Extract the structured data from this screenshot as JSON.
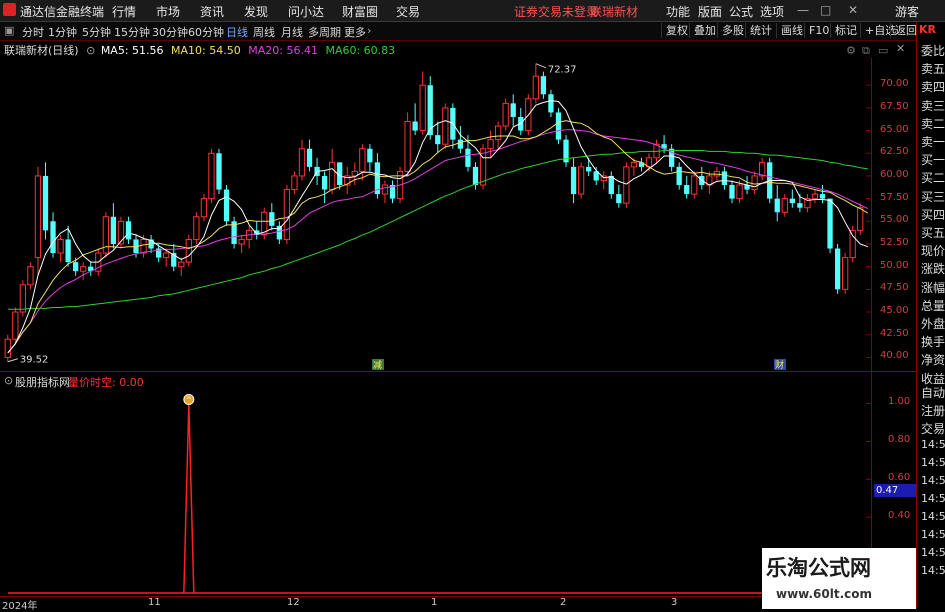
{
  "menubar": {
    "app_title": "通达信金融终端",
    "menus": [
      "行情",
      "市场",
      "资讯",
      "发现",
      "问小达",
      "财富圈",
      "交易"
    ],
    "notice": "证券交易未登录",
    "stock": "联瑞新材",
    "right_menus": [
      "功能",
      "版面",
      "公式",
      "选项"
    ],
    "guest": "游客"
  },
  "periodbar": {
    "periods": [
      "分时",
      "1分钟",
      "5分钟",
      "15分钟",
      "30分钟",
      "60分钟",
      "日线",
      "周线",
      "月线",
      "多周期",
      "更多"
    ],
    "active_period": "日线",
    "tools": [
      "复权",
      "叠加",
      "多股",
      "统计",
      "画线",
      "F10",
      "标记",
      "+自选",
      "返回"
    ]
  },
  "main_chart": {
    "title": "联瑞新材(日线)",
    "ma_labels": [
      {
        "name": "MA5: 51.56",
        "color": "#ffffff"
      },
      {
        "name": "MA10: 54.50",
        "color": "#f0e060"
      },
      {
        "name": "MA20: 56.41",
        "color": "#e040e0"
      },
      {
        "name": "MA60: 60.83",
        "color": "#30d030"
      }
    ],
    "high_mark": "72.37",
    "low_mark": "39.52",
    "event_markers": [
      "减",
      "财"
    ]
  },
  "sub_chart": {
    "title": "股朋指标网",
    "indicator": "量价时空: 0.00",
    "current_value": "0.47"
  },
  "right_panel": {
    "code": "KR",
    "items": [
      "委比",
      "卖五",
      "卖四",
      "卖三",
      "卖二",
      "卖一",
      "买一",
      "买二",
      "买三",
      "买四",
      "买五",
      "现价",
      "涨跌",
      "涨幅",
      "总量",
      "外盘",
      "换手",
      "净资",
      "收益"
    ],
    "sub_items": [
      "自动",
      "注册",
      "交易"
    ],
    "times": [
      "14:5",
      "14:5",
      "14:5",
      "14:5",
      "14:5",
      "14:5",
      "14:5",
      "14:5"
    ]
  },
  "x_axis": [
    "2024年",
    "11",
    "12",
    "1",
    "2",
    "3"
  ],
  "watermark": {
    "brand": "乐淘公式网",
    "url": "www.60lt.com"
  },
  "chart_data": {
    "type": "candlestick",
    "ylim": [
      38.5,
      73
    ],
    "y_ticks": [
      "70.00",
      "67.50",
      "65.00",
      "62.50",
      "60.00",
      "57.50",
      "55.00",
      "52.50",
      "50.00",
      "47.50",
      "45.00",
      "42.50",
      "40.00"
    ],
    "sub_ylim": [
      0,
      1.05
    ],
    "sub_y_ticks": [
      "1.00",
      "0.80",
      "0.60",
      "0.40"
    ],
    "colors": {
      "up": "#ff3232",
      "down": "#54ffff",
      "ma5": "#ffffff",
      "ma10": "#f0e060",
      "ma20": "#e040e0",
      "ma60": "#30d030",
      "indicator": "#ff2020"
    },
    "ohlc": [
      [
        40.0,
        42.5,
        39.52,
        42.0
      ],
      [
        42.0,
        45.5,
        41.5,
        45.0
      ],
      [
        45.0,
        48.5,
        44.5,
        48.0
      ],
      [
        48.0,
        50.5,
        47.5,
        50.0
      ],
      [
        51.0,
        61.0,
        49.0,
        60.0
      ],
      [
        60.0,
        61.5,
        53.0,
        54.0
      ],
      [
        55.0,
        56.0,
        51.0,
        51.5
      ],
      [
        51.5,
        53.5,
        50.5,
        53.0
      ],
      [
        53.0,
        54.5,
        50.0,
        50.5
      ],
      [
        50.5,
        51.0,
        49.0,
        49.5
      ],
      [
        49.5,
        50.5,
        48.5,
        50.0
      ],
      [
        50.0,
        50.5,
        49.0,
        49.5
      ],
      [
        49.5,
        52.0,
        49.0,
        51.5
      ],
      [
        51.5,
        56.0,
        51.0,
        55.5
      ],
      [
        55.5,
        57.0,
        52.0,
        52.5
      ],
      [
        52.5,
        55.5,
        52.0,
        55.0
      ],
      [
        55.0,
        55.5,
        52.5,
        53.0
      ],
      [
        53.0,
        53.5,
        51.0,
        51.5
      ],
      [
        51.5,
        53.5,
        51.0,
        53.0
      ],
      [
        53.0,
        53.5,
        51.5,
        52.0
      ],
      [
        52.0,
        52.5,
        50.5,
        51.0
      ],
      [
        51.0,
        52.0,
        50.0,
        51.5
      ],
      [
        51.5,
        52.5,
        49.5,
        50.0
      ],
      [
        50.0,
        51.0,
        49.0,
        50.5
      ],
      [
        50.5,
        53.5,
        50.0,
        53.0
      ],
      [
        53.0,
        56.0,
        52.5,
        55.5
      ],
      [
        55.5,
        58.0,
        55.0,
        57.5
      ],
      [
        57.5,
        63.0,
        57.0,
        62.5
      ],
      [
        62.5,
        63.0,
        58.0,
        58.5
      ],
      [
        58.5,
        59.0,
        54.5,
        55.0
      ],
      [
        55.0,
        55.5,
        52.0,
        52.5
      ],
      [
        52.5,
        53.5,
        51.5,
        53.0
      ],
      [
        53.0,
        54.5,
        52.0,
        54.0
      ],
      [
        54.0,
        55.0,
        53.0,
        53.5
      ],
      [
        53.5,
        56.5,
        53.0,
        56.0
      ],
      [
        56.0,
        57.0,
        54.0,
        54.5
      ],
      [
        54.5,
        55.0,
        52.5,
        53.0
      ],
      [
        53.0,
        59.0,
        52.5,
        58.5
      ],
      [
        58.5,
        60.5,
        58.0,
        60.0
      ],
      [
        60.0,
        64.0,
        59.5,
        63.0
      ],
      [
        63.0,
        64.0,
        60.5,
        61.0
      ],
      [
        61.0,
        62.0,
        59.0,
        60.0
      ],
      [
        60.0,
        60.5,
        57.0,
        58.5
      ],
      [
        58.5,
        63.0,
        58.0,
        61.5
      ],
      [
        61.5,
        61.5,
        58.5,
        59.0
      ],
      [
        59.0,
        61.0,
        58.0,
        60.0
      ],
      [
        60.0,
        61.5,
        59.0,
        60.5
      ],
      [
        60.5,
        63.5,
        59.5,
        63.0
      ],
      [
        63.0,
        63.5,
        60.5,
        61.5
      ],
      [
        61.5,
        62.5,
        57.5,
        58.0
      ],
      [
        58.0,
        59.5,
        57.0,
        59.0
      ],
      [
        59.0,
        59.5,
        57.0,
        57.5
      ],
      [
        57.5,
        61.0,
        57.0,
        60.5
      ],
      [
        60.5,
        67.0,
        60.0,
        66.0
      ],
      [
        66.0,
        68.0,
        64.5,
        65.0
      ],
      [
        65.0,
        71.5,
        64.5,
        70.0
      ],
      [
        70.0,
        71.0,
        64.0,
        64.5
      ],
      [
        64.5,
        66.0,
        62.5,
        63.5
      ],
      [
        63.5,
        68.0,
        63.0,
        67.5
      ],
      [
        67.5,
        68.0,
        63.0,
        64.0
      ],
      [
        64.0,
        65.5,
        62.5,
        63.0
      ],
      [
        63.0,
        64.5,
        60.5,
        61.0
      ],
      [
        61.0,
        61.5,
        58.5,
        59.0
      ],
      [
        59.0,
        63.5,
        58.5,
        63.0
      ],
      [
        63.0,
        65.0,
        62.0,
        64.0
      ],
      [
        64.0,
        66.0,
        63.0,
        65.5
      ],
      [
        65.5,
        68.5,
        65.0,
        68.0
      ],
      [
        68.0,
        69.0,
        65.5,
        66.5
      ],
      [
        66.5,
        67.5,
        64.5,
        65.0
      ],
      [
        65.0,
        69.0,
        64.5,
        68.5
      ],
      [
        68.5,
        72.37,
        68.0,
        71.0
      ],
      [
        71.0,
        71.5,
        68.5,
        69.0
      ],
      [
        69.0,
        69.5,
        66.5,
        67.0
      ],
      [
        67.0,
        67.5,
        63.5,
        64.0
      ],
      [
        64.0,
        64.5,
        61.0,
        61.5
      ],
      [
        61.0,
        62.0,
        57.0,
        58.0
      ],
      [
        58.0,
        61.5,
        57.5,
        61.0
      ],
      [
        61.0,
        62.0,
        60.0,
        60.5
      ],
      [
        60.5,
        61.0,
        59.0,
        59.5
      ],
      [
        59.5,
        60.5,
        58.5,
        60.0
      ],
      [
        60.0,
        60.5,
        57.5,
        58.0
      ],
      [
        58.0,
        59.0,
        56.5,
        57.0
      ],
      [
        57.0,
        61.5,
        56.5,
        61.0
      ],
      [
        61.0,
        62.0,
        60.0,
        61.5
      ],
      [
        61.5,
        62.0,
        60.5,
        61.0
      ],
      [
        61.0,
        62.5,
        60.5,
        62.0
      ],
      [
        62.0,
        64.0,
        61.5,
        63.5
      ],
      [
        63.5,
        64.5,
        62.5,
        63.0
      ],
      [
        63.0,
        63.5,
        60.5,
        61.0
      ],
      [
        61.0,
        61.5,
        58.5,
        59.0
      ],
      [
        59.0,
        60.0,
        57.5,
        58.0
      ],
      [
        58.0,
        60.5,
        57.5,
        60.0
      ],
      [
        60.0,
        61.0,
        58.5,
        59.0
      ],
      [
        59.0,
        60.5,
        58.0,
        60.0
      ],
      [
        60.0,
        61.0,
        59.5,
        60.5
      ],
      [
        60.5,
        61.0,
        58.5,
        59.0
      ],
      [
        59.0,
        59.5,
        57.0,
        57.5
      ],
      [
        57.5,
        59.5,
        57.0,
        59.0
      ],
      [
        59.0,
        60.0,
        58.0,
        58.5
      ],
      [
        58.5,
        60.5,
        58.0,
        60.0
      ],
      [
        60.0,
        62.0,
        59.5,
        61.5
      ],
      [
        61.5,
        62.0,
        57.0,
        57.5
      ],
      [
        57.5,
        59.0,
        55.0,
        56.0
      ],
      [
        56.0,
        58.0,
        55.5,
        57.5
      ],
      [
        57.5,
        58.5,
        56.5,
        57.0
      ],
      [
        57.0,
        58.0,
        56.0,
        56.5
      ],
      [
        56.5,
        58.0,
        56.0,
        57.5
      ],
      [
        57.5,
        58.5,
        57.0,
        58.0
      ],
      [
        58.0,
        59.0,
        57.0,
        57.5
      ],
      [
        57.5,
        57.5,
        51.5,
        52.0
      ],
      [
        52.0,
        52.5,
        47.0,
        47.5
      ],
      [
        47.5,
        51.5,
        47.0,
        51.0
      ],
      [
        51.0,
        54.5,
        50.5,
        54.0
      ],
      [
        54.0,
        57.0,
        53.5,
        56.5
      ]
    ],
    "ma5": [
      40.5,
      41.5,
      43.3,
      45.4,
      49.0,
      51.4,
      52.7,
      53.7,
      54.2,
      52.5,
      51.2,
      50.5,
      50.5,
      51.2,
      51.8,
      52.8,
      53.7,
      53.5,
      53.1,
      52.9,
      52.3,
      51.8,
      51.3,
      50.8,
      51.2,
      52.1,
      53.3,
      55.7,
      57.3,
      57.7,
      57.2,
      56.3,
      54.6,
      53.6,
      53.8,
      54.2,
      54.2,
      55.1,
      56.4,
      57.8,
      59.1,
      60.5,
      60.6,
      60.8,
      60.0,
      59.8,
      59.9,
      60.4,
      60.4,
      60.2,
      60.1,
      59.8,
      59.7,
      60.2,
      61.5,
      63.7,
      65.2,
      65.8,
      66.1,
      65.8,
      64.5,
      63.8,
      63.1,
      62.0,
      62.0,
      62.9,
      63.9,
      65.4,
      65.8,
      66.7,
      67.8,
      68.1,
      68.3,
      68.2,
      67.2,
      65.2,
      63.2,
      61.8,
      60.6,
      59.8,
      59.9,
      59.4,
      59.1,
      59.7,
      60.1,
      60.8,
      61.4,
      62.2,
      62.2,
      62.0,
      61.1,
      60.3,
      59.5,
      59.0,
      59.4,
      59.5,
      59.4,
      59.2,
      59.0,
      58.8,
      59.2,
      59.5,
      59.5,
      59.5,
      59.3,
      57.7,
      57.3,
      57.4,
      57.4,
      57.3,
      56.5,
      54.9,
      53.4,
      52.5,
      52.2
    ],
    "ma10": [
      40.5,
      41.5,
      42.8,
      43.8,
      45.9,
      47.2,
      48.5,
      49.5,
      50.3,
      50.7,
      51.3,
      51.6,
      51.9,
      52.2,
      52.2,
      52.1,
      52.2,
      52.2,
      52.4,
      52.5,
      52.6,
      52.4,
      52.3,
      52.2,
      52.0,
      52.3,
      52.8,
      53.4,
      54.2,
      54.6,
      54.6,
      54.8,
      55.1,
      55.0,
      55.0,
      55.0,
      55.3,
      55.4,
      55.9,
      57.0,
      57.5,
      57.7,
      58.0,
      58.5,
      58.8,
      59.1,
      59.6,
      59.8,
      60.2,
      60.0,
      59.9,
      60.0,
      60.0,
      60.0,
      60.5,
      61.3,
      61.8,
      62.6,
      63.2,
      63.4,
      63.7,
      63.9,
      63.9,
      64.1,
      64.3,
      64.4,
      64.4,
      64.4,
      64.1,
      64.1,
      64.3,
      64.8,
      65.3,
      65.9,
      66.1,
      65.9,
      65.8,
      65.4,
      64.7,
      64.3,
      64.0,
      63.2,
      62.4,
      61.7,
      61.5,
      61.0,
      60.5,
      60.2,
      60.3,
      60.5,
      60.4,
      60.3,
      60.4,
      60.2,
      60.2,
      60.1,
      59.9,
      59.8,
      59.3,
      59.1,
      59.2,
      59.3,
      59.2,
      59.2,
      59.1,
      58.9,
      58.7,
      58.5,
      58.3,
      58.2,
      57.7,
      57.3,
      56.8,
      56.4,
      55.9
    ],
    "ma20": [
      40.5,
      41.5,
      42.8,
      43.8,
      45.1,
      46.2,
      47.0,
      47.7,
      48.2,
      48.6,
      49.1,
      49.5,
      49.9,
      50.3,
      50.6,
      50.9,
      51.2,
      51.4,
      51.6,
      51.7,
      51.8,
      51.9,
      51.9,
      52.0,
      52.1,
      52.2,
      52.3,
      52.6,
      52.9,
      53.1,
      53.3,
      53.4,
      53.5,
      53.6,
      53.6,
      53.7,
      53.9,
      54.1,
      54.5,
      55.2,
      55.9,
      56.3,
      56.7,
      57.1,
      57.3,
      57.4,
      57.6,
      57.7,
      58.1,
      58.5,
      58.7,
      58.8,
      59.0,
      59.3,
      59.7,
      60.2,
      60.7,
      61.2,
      61.7,
      61.9,
      62.1,
      62.3,
      62.4,
      62.5,
      62.7,
      62.9,
      63.2,
      63.5,
      63.8,
      64.0,
      64.3,
      64.6,
      64.8,
      65.0,
      65.1,
      65.1,
      65.0,
      64.9,
      64.6,
      64.4,
      64.3,
      64.2,
      64.1,
      64.0,
      63.9,
      63.7,
      63.4,
      63.0,
      62.6,
      62.3,
      62.1,
      61.9,
      61.7,
      61.5,
      61.4,
      61.2,
      61.0,
      60.8,
      60.5,
      60.3,
      60.1,
      59.9,
      59.7,
      59.5,
      59.3,
      59.1,
      58.9,
      58.7,
      58.5,
      58.3,
      58.0,
      57.6,
      57.2,
      56.8,
      56.4
    ],
    "ma60": [
      45.3,
      45.3,
      45.3,
      45.4,
      45.4,
      45.4,
      45.5,
      45.5,
      45.6,
      45.6,
      45.7,
      45.8,
      45.9,
      46.0,
      46.1,
      46.2,
      46.3,
      46.4,
      46.5,
      46.6,
      46.8,
      46.9,
      47.0,
      47.2,
      47.4,
      47.6,
      47.8,
      48.0,
      48.2,
      48.4,
      48.6,
      48.8,
      49.1,
      49.3,
      49.5,
      49.8,
      50.0,
      50.3,
      50.6,
      50.9,
      51.2,
      51.5,
      51.8,
      52.1,
      52.4,
      52.8,
      53.1,
      53.5,
      53.8,
      54.2,
      54.6,
      55.0,
      55.4,
      55.8,
      56.2,
      56.6,
      57.0,
      57.4,
      57.8,
      58.1,
      58.5,
      58.8,
      59.1,
      59.4,
      59.7,
      60.0,
      60.3,
      60.5,
      60.8,
      61.0,
      61.2,
      61.4,
      61.6,
      61.8,
      61.9,
      62.0,
      62.1,
      62.2,
      62.3,
      62.4,
      62.4,
      62.5,
      62.6,
      62.6,
      62.7,
      62.7,
      62.7,
      62.8,
      62.8,
      62.8,
      62.8,
      62.8,
      62.8,
      62.7,
      62.7,
      62.7,
      62.6,
      62.6,
      62.5,
      62.5,
      62.4,
      62.3,
      62.3,
      62.2,
      62.1,
      62.0,
      61.9,
      61.8,
      61.7,
      61.5,
      61.4,
      61.2,
      61.1,
      60.9,
      60.8
    ],
    "indicator": {
      "spike_index": 24,
      "spike_value": 1.0
    }
  }
}
